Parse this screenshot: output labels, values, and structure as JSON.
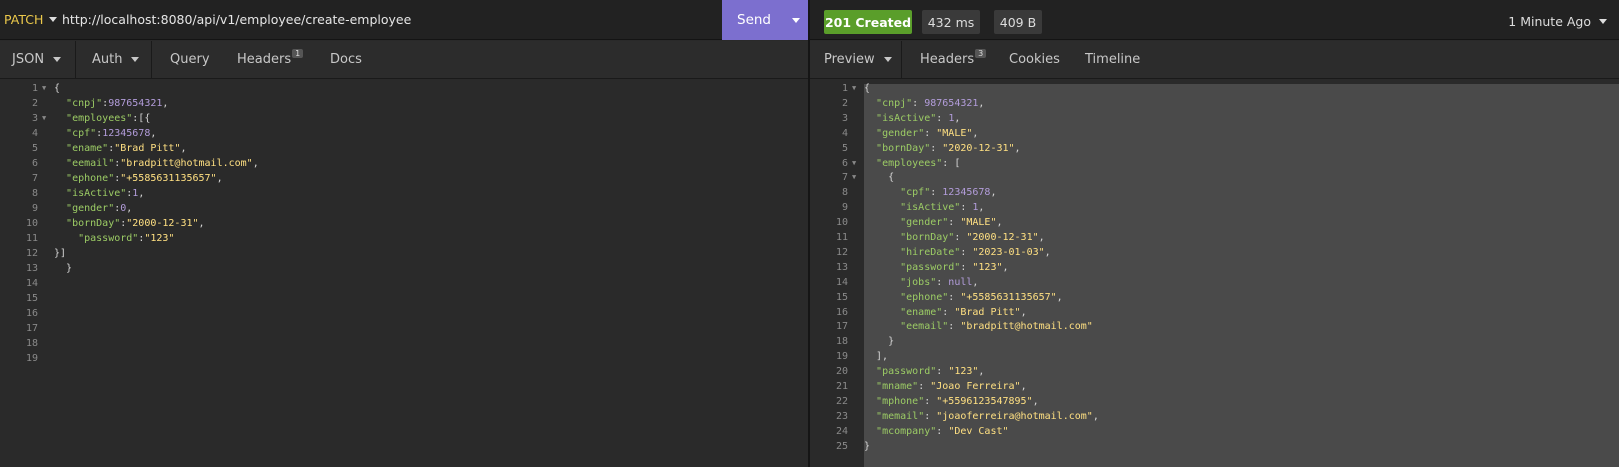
{
  "request": {
    "method": "PATCH",
    "url": "http://localhost:8080/api/v1/employee/create-employee",
    "send_label": "Send"
  },
  "response": {
    "status": "201 Created",
    "time": "432 ms",
    "size": "409 B",
    "ago": "1 Minute Ago"
  },
  "left_tabs": {
    "body": "JSON",
    "auth": "Auth",
    "query": "Query",
    "headers": "Headers",
    "headers_count": "1",
    "docs": "Docs"
  },
  "right_tabs": {
    "preview": "Preview",
    "headers": "Headers",
    "headers_count": "3",
    "cookies": "Cookies",
    "timeline": "Timeline"
  },
  "colors": {
    "accent": "#7c6fcf",
    "status_ok": "#5a9e2a",
    "key": "#9ccc65",
    "string": "#ffe082",
    "number": "#b39ddb"
  },
  "request_body": [
    {
      "ln": "1",
      "fold": true,
      "t": [
        [
          "p",
          "{"
        ]
      ]
    },
    {
      "ln": "2",
      "t": [
        [
          "p",
          "  "
        ],
        [
          "k",
          "\"cnpj\""
        ],
        [
          "p",
          ":"
        ],
        [
          "n",
          "987654321"
        ],
        [
          "p",
          ","
        ]
      ]
    },
    {
      "ln": "3",
      "fold": true,
      "t": [
        [
          "p",
          "  "
        ],
        [
          "k",
          "\"employees\""
        ],
        [
          "p",
          ":[{"
        ]
      ]
    },
    {
      "ln": "4",
      "t": [
        [
          "p",
          "  "
        ],
        [
          "k",
          "\"cpf\""
        ],
        [
          "p",
          ":"
        ],
        [
          "n",
          "12345678"
        ],
        [
          "p",
          ","
        ]
      ]
    },
    {
      "ln": "5",
      "t": [
        [
          "p",
          "  "
        ],
        [
          "k",
          "\"ename\""
        ],
        [
          "p",
          ":"
        ],
        [
          "s",
          "\"Brad Pitt\""
        ],
        [
          "p",
          ","
        ]
      ]
    },
    {
      "ln": "6",
      "t": [
        [
          "p",
          "  "
        ],
        [
          "k",
          "\"eemail\""
        ],
        [
          "p",
          ":"
        ],
        [
          "s",
          "\"bradpitt@hotmail.com\""
        ],
        [
          "p",
          ","
        ]
      ]
    },
    {
      "ln": "7",
      "t": [
        [
          "p",
          "  "
        ],
        [
          "k",
          "\"ephone\""
        ],
        [
          "p",
          ":"
        ],
        [
          "s",
          "\"+5585631135657\""
        ],
        [
          "p",
          ","
        ]
      ]
    },
    {
      "ln": "8",
      "t": [
        [
          "p",
          "  "
        ],
        [
          "k",
          "\"isActive\""
        ],
        [
          "p",
          ":"
        ],
        [
          "n",
          "1"
        ],
        [
          "p",
          ","
        ]
      ]
    },
    {
      "ln": "9",
      "t": [
        [
          "p",
          "  "
        ],
        [
          "k",
          "\"gender\""
        ],
        [
          "p",
          ":"
        ],
        [
          "n",
          "0"
        ],
        [
          "p",
          ","
        ]
      ]
    },
    {
      "ln": "10",
      "t": [
        [
          "p",
          "  "
        ],
        [
          "k",
          "\"bornDay\""
        ],
        [
          "p",
          ":"
        ],
        [
          "s",
          "\"2000-12-31\""
        ],
        [
          "p",
          ","
        ]
      ]
    },
    {
      "ln": "11",
      "t": [
        [
          "p",
          "    "
        ],
        [
          "k",
          "\"password\""
        ],
        [
          "p",
          ":"
        ],
        [
          "s",
          "\"123\""
        ]
      ]
    },
    {
      "ln": "12",
      "t": [
        [
          "p",
          "}]"
        ]
      ]
    },
    {
      "ln": "13",
      "t": [
        [
          "p",
          "  }"
        ]
      ]
    },
    {
      "ln": "14",
      "t": []
    },
    {
      "ln": "15",
      "t": []
    },
    {
      "ln": "16",
      "t": []
    },
    {
      "ln": "17",
      "t": []
    },
    {
      "ln": "18",
      "t": []
    },
    {
      "ln": "19",
      "t": []
    }
  ],
  "response_body": [
    {
      "ln": "1",
      "fold": true,
      "t": [
        [
          "p",
          "{"
        ]
      ]
    },
    {
      "ln": "2",
      "t": [
        [
          "p",
          "  "
        ],
        [
          "k",
          "\"cnpj\""
        ],
        [
          "p",
          ": "
        ],
        [
          "n",
          "987654321"
        ],
        [
          "p",
          ","
        ]
      ]
    },
    {
      "ln": "3",
      "t": [
        [
          "p",
          "  "
        ],
        [
          "k",
          "\"isActive\""
        ],
        [
          "p",
          ": "
        ],
        [
          "n",
          "1"
        ],
        [
          "p",
          ","
        ]
      ]
    },
    {
      "ln": "4",
      "t": [
        [
          "p",
          "  "
        ],
        [
          "k",
          "\"gender\""
        ],
        [
          "p",
          ": "
        ],
        [
          "s",
          "\"MALE\""
        ],
        [
          "p",
          ","
        ]
      ]
    },
    {
      "ln": "5",
      "t": [
        [
          "p",
          "  "
        ],
        [
          "k",
          "\"bornDay\""
        ],
        [
          "p",
          ": "
        ],
        [
          "s",
          "\"2020-12-31\""
        ],
        [
          "p",
          ","
        ]
      ]
    },
    {
      "ln": "6",
      "fold": true,
      "t": [
        [
          "p",
          "  "
        ],
        [
          "k",
          "\"employees\""
        ],
        [
          "p",
          ": ["
        ]
      ]
    },
    {
      "ln": "7",
      "fold": true,
      "t": [
        [
          "p",
          "    {"
        ]
      ]
    },
    {
      "ln": "8",
      "t": [
        [
          "p",
          "      "
        ],
        [
          "k",
          "\"cpf\""
        ],
        [
          "p",
          ": "
        ],
        [
          "n",
          "12345678"
        ],
        [
          "p",
          ","
        ]
      ]
    },
    {
      "ln": "9",
      "t": [
        [
          "p",
          "      "
        ],
        [
          "k",
          "\"isActive\""
        ],
        [
          "p",
          ": "
        ],
        [
          "n",
          "1"
        ],
        [
          "p",
          ","
        ]
      ]
    },
    {
      "ln": "10",
      "t": [
        [
          "p",
          "      "
        ],
        [
          "k",
          "\"gender\""
        ],
        [
          "p",
          ": "
        ],
        [
          "s",
          "\"MALE\""
        ],
        [
          "p",
          ","
        ]
      ]
    },
    {
      "ln": "11",
      "t": [
        [
          "p",
          "      "
        ],
        [
          "k",
          "\"bornDay\""
        ],
        [
          "p",
          ": "
        ],
        [
          "s",
          "\"2000-12-31\""
        ],
        [
          "p",
          ","
        ]
      ]
    },
    {
      "ln": "12",
      "t": [
        [
          "p",
          "      "
        ],
        [
          "k",
          "\"hireDate\""
        ],
        [
          "p",
          ": "
        ],
        [
          "s",
          "\"2023-01-03\""
        ],
        [
          "p",
          ","
        ]
      ]
    },
    {
      "ln": "13",
      "t": [
        [
          "p",
          "      "
        ],
        [
          "k",
          "\"password\""
        ],
        [
          "p",
          ": "
        ],
        [
          "s",
          "\"123\""
        ],
        [
          "p",
          ","
        ]
      ]
    },
    {
      "ln": "14",
      "t": [
        [
          "p",
          "      "
        ],
        [
          "k",
          "\"jobs\""
        ],
        [
          "p",
          ": "
        ],
        [
          "n",
          "null"
        ],
        [
          "p",
          ","
        ]
      ]
    },
    {
      "ln": "15",
      "t": [
        [
          "p",
          "      "
        ],
        [
          "k",
          "\"ephone\""
        ],
        [
          "p",
          ": "
        ],
        [
          "s",
          "\"+5585631135657\""
        ],
        [
          "p",
          ","
        ]
      ]
    },
    {
      "ln": "16",
      "t": [
        [
          "p",
          "      "
        ],
        [
          "k",
          "\"ename\""
        ],
        [
          "p",
          ": "
        ],
        [
          "s",
          "\"Brad Pitt\""
        ],
        [
          "p",
          ","
        ]
      ]
    },
    {
      "ln": "17",
      "t": [
        [
          "p",
          "      "
        ],
        [
          "k",
          "\"eemail\""
        ],
        [
          "p",
          ": "
        ],
        [
          "s",
          "\"bradpitt@hotmail.com\""
        ]
      ]
    },
    {
      "ln": "18",
      "t": [
        [
          "p",
          "    }"
        ]
      ]
    },
    {
      "ln": "19",
      "t": [
        [
          "p",
          "  ],"
        ]
      ]
    },
    {
      "ln": "20",
      "t": [
        [
          "p",
          "  "
        ],
        [
          "k",
          "\"password\""
        ],
        [
          "p",
          ": "
        ],
        [
          "s",
          "\"123\""
        ],
        [
          "p",
          ","
        ]
      ]
    },
    {
      "ln": "21",
      "t": [
        [
          "p",
          "  "
        ],
        [
          "k",
          "\"mname\""
        ],
        [
          "p",
          ": "
        ],
        [
          "s",
          "\"Joao Ferreira\""
        ],
        [
          "p",
          ","
        ]
      ]
    },
    {
      "ln": "22",
      "t": [
        [
          "p",
          "  "
        ],
        [
          "k",
          "\"mphone\""
        ],
        [
          "p",
          ": "
        ],
        [
          "s",
          "\"+5596123547895\""
        ],
        [
          "p",
          ","
        ]
      ]
    },
    {
      "ln": "23",
      "t": [
        [
          "p",
          "  "
        ],
        [
          "k",
          "\"memail\""
        ],
        [
          "p",
          ": "
        ],
        [
          "s",
          "\"joaoferreira@hotmail.com\""
        ],
        [
          "p",
          ","
        ]
      ]
    },
    {
      "ln": "24",
      "t": [
        [
          "p",
          "  "
        ],
        [
          "k",
          "\"mcompany\""
        ],
        [
          "p",
          ": "
        ],
        [
          "s",
          "\"Dev Cast\""
        ]
      ]
    },
    {
      "ln": "25",
      "t": [
        [
          "p",
          "}"
        ]
      ]
    }
  ]
}
